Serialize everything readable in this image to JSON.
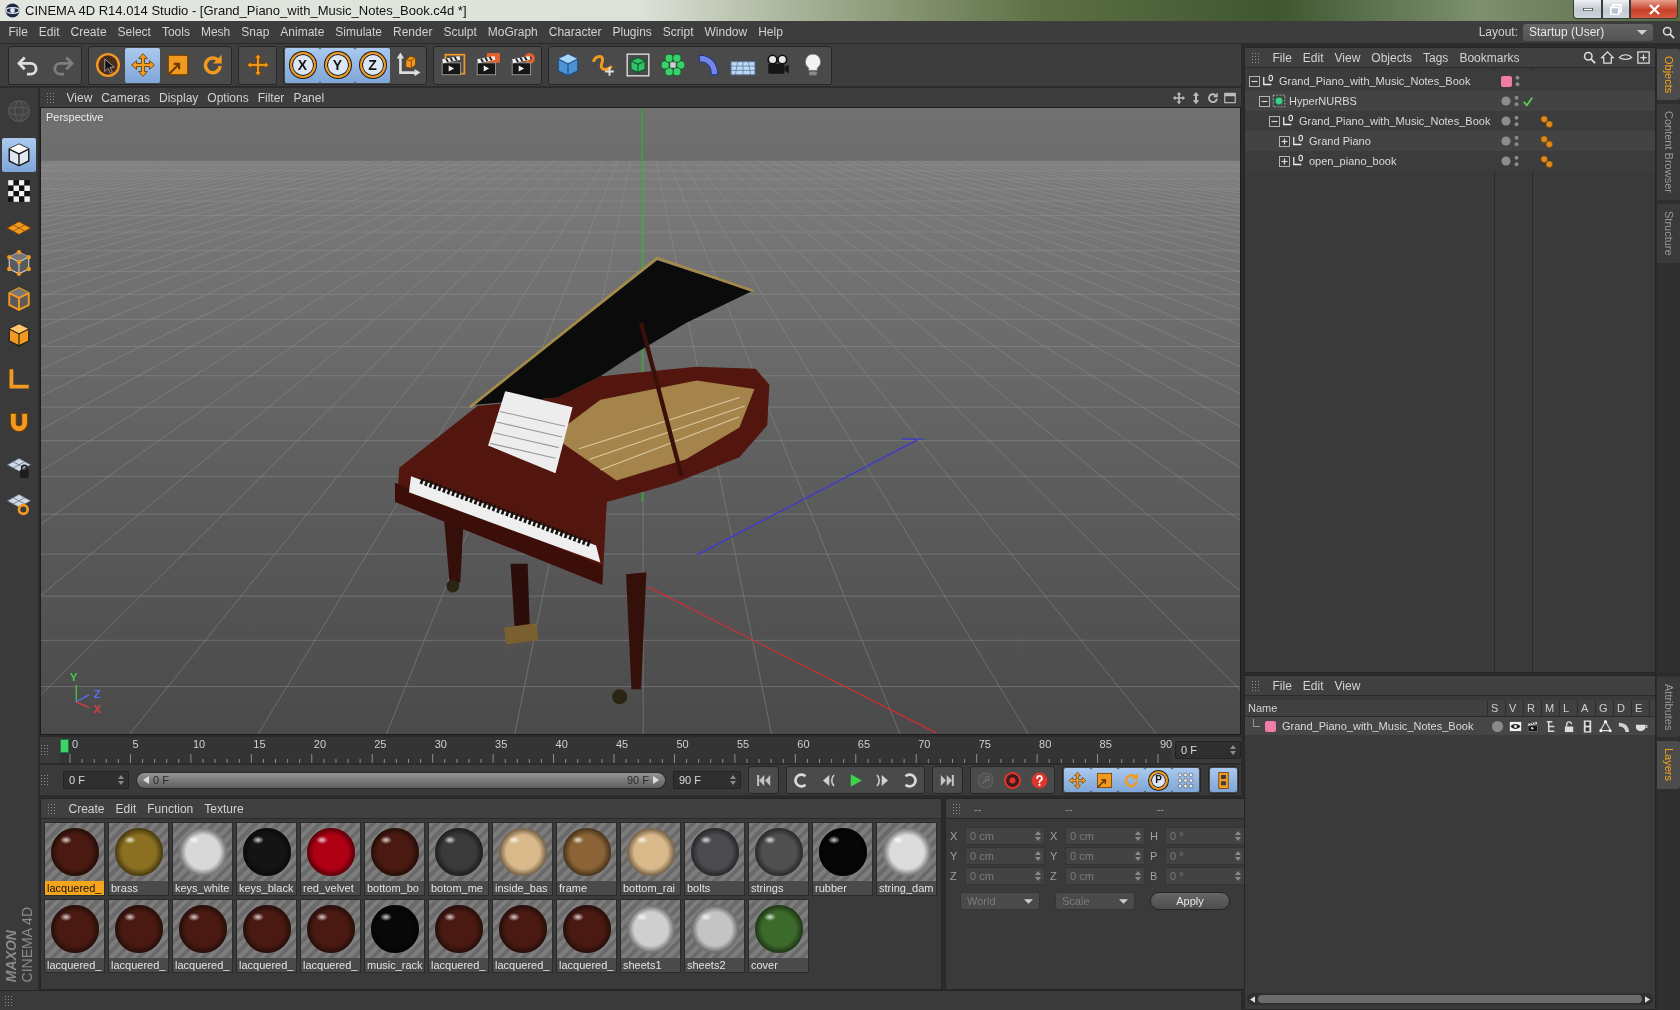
{
  "window": {
    "title": "CINEMA 4D R14.014 Studio - [Grand_Piano_with_Music_Notes_Book.c4d *]"
  },
  "menu": [
    "File",
    "Edit",
    "Create",
    "Select",
    "Tools",
    "Mesh",
    "Snap",
    "Animate",
    "Simulate",
    "Render",
    "Sculpt",
    "MoGraph",
    "Character",
    "Plugins",
    "Script",
    "Window",
    "Help"
  ],
  "layout": {
    "label": "Layout:",
    "value": "Startup (User)"
  },
  "toolbar": {
    "groups": [
      [
        {
          "kind": "undo",
          "disabled": false
        },
        {
          "kind": "redo",
          "disabled": true
        }
      ],
      [
        {
          "kind": "selection",
          "selected": false
        },
        {
          "kind": "move",
          "selected": true
        },
        {
          "kind": "scale",
          "selected": false
        },
        {
          "kind": "rotate",
          "selected": false
        }
      ],
      [
        {
          "kind": "recent-tool"
        }
      ],
      [
        {
          "kind": "axis-lock",
          "label": "X",
          "selected": true
        },
        {
          "kind": "axis-lock",
          "label": "Y",
          "selected": true
        },
        {
          "kind": "axis-lock",
          "label": "Z",
          "selected": true
        },
        {
          "kind": "coordinate-system",
          "selected": false
        }
      ],
      [
        {
          "kind": "render-view"
        },
        {
          "kind": "render"
        },
        {
          "kind": "render-settings"
        }
      ],
      [
        {
          "kind": "cube"
        },
        {
          "kind": "spline"
        },
        {
          "kind": "subdivision-surface"
        },
        {
          "kind": "cloner"
        },
        {
          "kind": "deformer"
        },
        {
          "kind": "floor"
        },
        {
          "kind": "camera"
        },
        {
          "kind": "light"
        }
      ]
    ]
  },
  "tool_palette": {
    "groups": [
      [
        {
          "kind": "make-editable",
          "disabled": true
        }
      ],
      [
        {
          "kind": "model-mode",
          "selected": true
        },
        {
          "kind": "texture-mode",
          "selected": false
        },
        {
          "kind": "workplane-mode",
          "selected": false
        },
        {
          "kind": "points-mode",
          "selected": false
        },
        {
          "kind": "edges-mode",
          "selected": false
        },
        {
          "kind": "polygons-mode",
          "selected": false
        }
      ],
      [
        {
          "kind": "axis-mode",
          "selected": false
        }
      ],
      [
        {
          "kind": "tweak-mode",
          "selected": false
        }
      ],
      [
        {
          "kind": "snap",
          "selected": false
        },
        {
          "kind": "snap-settings",
          "selected": false
        }
      ]
    ]
  },
  "brand": {
    "company": "MAXON",
    "product": "CINEMA 4D"
  },
  "viewport": {
    "menu": [
      "View",
      "Cameras",
      "Display",
      "Options",
      "Filter",
      "Panel"
    ],
    "camera": "Perspective",
    "axis_labels": [
      {
        "label": "Y",
        "color": "#44c844"
      },
      {
        "label": "Z",
        "color": "#5a6cf0"
      },
      {
        "label": "X",
        "color": "#dc3c3c"
      }
    ]
  },
  "timeline": {
    "ticks": [
      "0",
      "5",
      "10",
      "15",
      "20",
      "25",
      "30",
      "35",
      "40",
      "45",
      "50",
      "55",
      "60",
      "65",
      "70",
      "75",
      "80",
      "85",
      "90"
    ],
    "level": 0,
    "frame": "0 F"
  },
  "transport": {
    "start_frame": "0 F",
    "range": {
      "from": "0 F",
      "to": "90 F",
      "level": 1
    },
    "end_frame": "90 F",
    "groups": [
      [
        {
          "kind": "go-to-start"
        }
      ],
      [
        {
          "kind": "previous-key"
        },
        {
          "kind": "previous-frame"
        },
        {
          "kind": "play"
        },
        {
          "kind": "next-frame"
        },
        {
          "kind": "next-key"
        }
      ],
      [
        {
          "kind": "go-to-end"
        }
      ],
      [
        {
          "kind": "record-keys",
          "disabled": true
        },
        {
          "kind": "autokey",
          "disabled": false
        },
        {
          "kind": "keyframe-selection",
          "disabled": false
        }
      ],
      [
        {
          "kind": "position-key",
          "selected": true
        },
        {
          "kind": "scale-key",
          "selected": true
        },
        {
          "kind": "rotation-key",
          "selected": true
        },
        {
          "kind": "parameter-key",
          "label": "P",
          "selected": true
        },
        {
          "kind": "point-level-key",
          "selected": true
        }
      ],
      [
        {
          "kind": "timeline",
          "selected": true
        }
      ]
    ]
  },
  "materials": {
    "menu": [
      "Create",
      "Edit",
      "Function",
      "Texture"
    ],
    "items": [
      {
        "name": "lacquered_",
        "color": "#4a1a12",
        "selected": true
      },
      {
        "name": "brass",
        "color": "#8a7020",
        "selected": false
      },
      {
        "name": "keys_white",
        "color": "#d8d8d8",
        "selected": false
      },
      {
        "name": "keys_black",
        "color": "#141414",
        "selected": false
      },
      {
        "name": "red_velvet",
        "color": "#b00014",
        "selected": false
      },
      {
        "name": "bottom_bo",
        "color": "#4a1a12",
        "selected": false
      },
      {
        "name": "botom_me",
        "color": "#3a3a3a",
        "selected": false
      },
      {
        "name": "inside_bas",
        "color": "#d9b88a",
        "selected": false
      },
      {
        "name": "frame",
        "color": "#8a6436",
        "selected": false
      },
      {
        "name": "bottom_rai",
        "color": "#d9b88a",
        "selected": false
      },
      {
        "name": "bolts",
        "color": "#4c4c50",
        "selected": false
      },
      {
        "name": "strings",
        "color": "#505050",
        "selected": false
      },
      {
        "name": "rubber",
        "color": "#060606",
        "selected": false
      },
      {
        "name": "string_dam",
        "color": "#dcdcdc",
        "selected": false
      },
      {
        "name": "lacquered_",
        "color": "#4a1a12",
        "selected": false
      },
      {
        "name": "lacquered_",
        "color": "#4a1a12",
        "selected": false
      },
      {
        "name": "lacquered_",
        "color": "#4a1a12",
        "selected": false
      },
      {
        "name": "lacquered_",
        "color": "#4a1a12",
        "selected": false
      },
      {
        "name": "lacquered_",
        "color": "#4a1a12",
        "selected": false
      },
      {
        "name": "music_rack",
        "color": "#080808",
        "selected": false
      },
      {
        "name": "lacquered_",
        "color": "#4a1a12",
        "selected": false
      },
      {
        "name": "lacquered_",
        "color": "#4a1a12",
        "selected": false
      },
      {
        "name": "lacquered_",
        "color": "#4a1a12",
        "selected": false
      },
      {
        "name": "sheets1",
        "color": "#cfcfcf",
        "selected": false
      },
      {
        "name": "sheets2",
        "color": "#c4c4c4",
        "selected": false
      },
      {
        "name": "cover",
        "color": "#3c6a2a",
        "selected": false
      }
    ]
  },
  "coordinates": {
    "headers": [
      "--",
      "--",
      "--"
    ],
    "disabled": true,
    "fields": [
      [
        {
          "axis": "X",
          "value": "0 cm"
        },
        {
          "axis": "X",
          "value": "0 cm"
        },
        {
          "axis": "H",
          "value": "0 °"
        }
      ],
      [
        {
          "axis": "Y",
          "value": "0 cm"
        },
        {
          "axis": "Y",
          "value": "0 cm"
        },
        {
          "axis": "P",
          "value": "0 °"
        }
      ],
      [
        {
          "axis": "Z",
          "value": "0 cm"
        },
        {
          "axis": "Z",
          "value": "0 cm"
        },
        {
          "axis": "B",
          "value": "0 °"
        }
      ]
    ],
    "dropdowns": [
      {
        "value": "World",
        "disabled": true
      },
      {
        "value": "Scale",
        "disabled": true
      }
    ],
    "button": "Apply"
  },
  "objects": {
    "menu": [
      "File",
      "Edit",
      "View",
      "Objects",
      "Tags",
      "Bookmarks"
    ],
    "tree": [
      {
        "name": "Grand_Piano_with_Music_Notes_Book",
        "kind": "null",
        "expanded": true,
        "color": "#f07ca8",
        "children": [
          {
            "name": "HyperNURBS",
            "kind": "hypernurbs",
            "expanded": true,
            "enabled": true,
            "children": [
              {
                "name": "Grand_Piano_with_Music_Notes_Book",
                "kind": "null",
                "expanded": true,
                "tags": [
                  {
                    "kind": "material"
                  }
                ],
                "children": [
                  {
                    "name": "Grand Piano",
                    "kind": "null",
                    "expanded": false,
                    "tags": [
                      {
                        "kind": "material"
                      }
                    ]
                  },
                  {
                    "name": "open_piano_book",
                    "kind": "null",
                    "expanded": false,
                    "tags": [
                      {
                        "kind": "material"
                      }
                    ]
                  }
                ]
              }
            ]
          }
        ]
      }
    ]
  },
  "layers": {
    "menu": [
      "File",
      "Edit",
      "View"
    ],
    "columns": [
      "Name",
      "S",
      "V",
      "R",
      "M",
      "L",
      "A",
      "G",
      "D",
      "E"
    ],
    "rows": [
      {
        "name": "Grand_Piano_with_Music_Notes_Book",
        "color": "#f07ca8"
      }
    ]
  },
  "side_tabs": {
    "upper": [
      {
        "label": "Objects",
        "selected": true
      },
      {
        "label": "Content Browser",
        "selected": false
      },
      {
        "label": "Structure",
        "selected": false
      }
    ],
    "lower": [
      {
        "label": "Attributes",
        "selected": false
      },
      {
        "label": "Layers",
        "selected": true
      }
    ]
  }
}
